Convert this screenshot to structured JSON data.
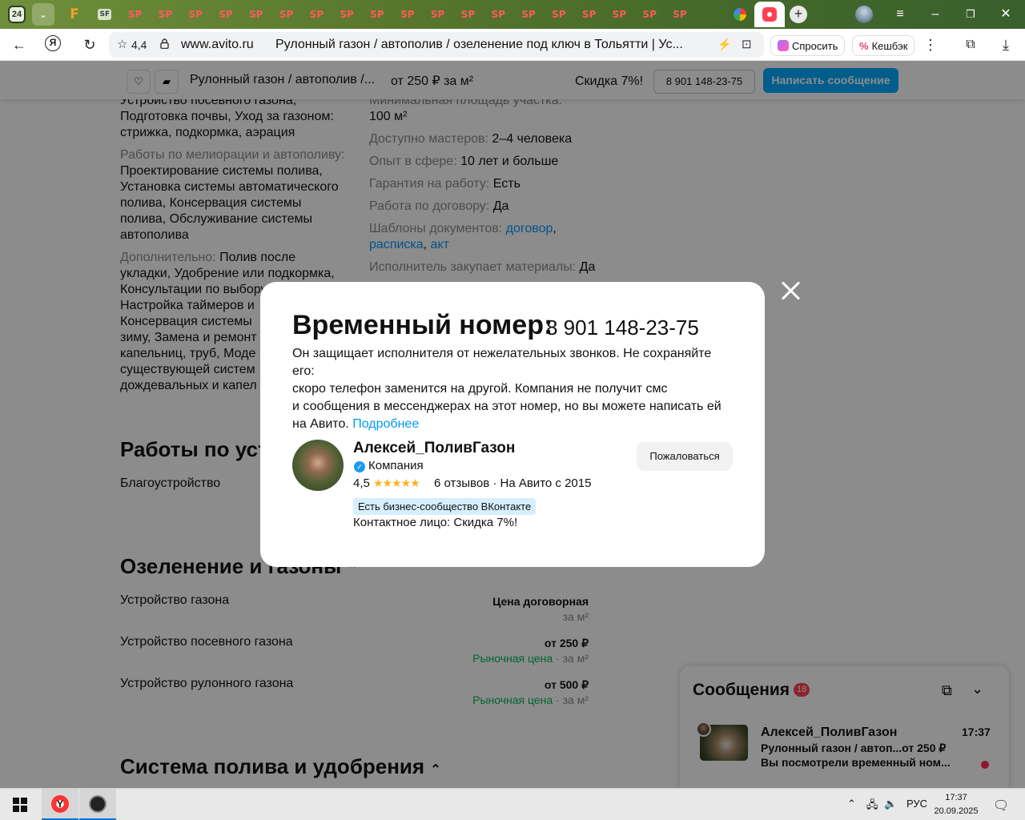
{
  "browser": {
    "tab_count_badge": "24",
    "favicons": [
      "F",
      "SF",
      "SP",
      "SP",
      "SP",
      "SP",
      "SP",
      "SP",
      "SP",
      "SP",
      "SP",
      "SP",
      "SP",
      "SP",
      "SP",
      "SP",
      "SP",
      "SP",
      "SP",
      "SP",
      "SP"
    ],
    "site_rating": "4,4",
    "domain": "www.avito.ru",
    "page_title": "Рулонный газон / автополив / озеленение под ключ в Тольятти | Ус...",
    "ask_label": "Спросить",
    "cashback_label": "Кешбэк"
  },
  "sticky": {
    "title": "Рулонный газон / автополив /...",
    "price": "от 250 ₽ за м²",
    "discount": "Скидка 7%!",
    "phone": "8 901 148-23-75",
    "message_button": "Написать сообщение"
  },
  "details_left": [
    {
      "text": "Устройство посевного газона,"
    },
    {
      "text": "Подготовка почвы, Уход за газоном:"
    },
    {
      "text": "стрижка, подкормка, аэрация"
    }
  ],
  "melioration": {
    "label": "Работы по мелиорации и автополиву:",
    "lines": [
      "Проектирование системы полива,",
      "Установка системы автоматического",
      "полива, Консервация системы",
      "полива, Обслуживание системы",
      "автополива"
    ]
  },
  "additional": {
    "label": "Дополнительно:",
    "first": "Полив после",
    "lines": [
      "укладки, Удобрение или подкормка,",
      "Консультации по выбору",
      "Настройка таймеров и",
      "Консервация системы",
      "зиму, Замена и ремонт",
      "капельниц, труб, Моде",
      "существующей систем",
      "дождевальных и капел"
    ]
  },
  "details_right": {
    "min_area_label": "Минимальная площадь участка:",
    "min_area_value": "100 м²",
    "masters_label": "Доступно мастеров:",
    "masters_value": "2–4 человека",
    "experience_label": "Опыт в сфере:",
    "experience_value": "10 лет и больше",
    "warranty_label": "Гарантия на работу:",
    "warranty_value": "Есть",
    "contract_label": "Работа по договору:",
    "contract_value": "Да",
    "templates_label": "Шаблоны документов:",
    "templates": [
      "договор",
      "расписка",
      "акт"
    ],
    "materials_label": "Исполнитель закупает материалы:",
    "materials_value": "Да"
  },
  "section_works": {
    "title": "Работы по уст",
    "item": "Благоустройство"
  },
  "section_greening": {
    "title": "Озеленение и газоны",
    "rows": [
      {
        "name": "Устройство газона",
        "price": "Цена договорная",
        "market": "",
        "unit": "за м²"
      },
      {
        "name": "Устройство посевного газона",
        "price": "от 250 ₽",
        "market": "Рыночная цена",
        "unit": "· за м²"
      },
      {
        "name": "Устройство рулонного газона",
        "price": "от 500 ₽",
        "market": "Рыночная цена",
        "unit": "· за м²"
      }
    ]
  },
  "section_irrigation": {
    "title": "Система полива и удобрения"
  },
  "messages": {
    "title": "Сообщения",
    "count": "18",
    "chat_name": "Алексей_ПоливГазон",
    "chat_time": "17:37",
    "chat_subject": "Рулонный газон / автоп...от 250 ₽",
    "chat_preview": "Вы посмотрели временный ном..."
  },
  "modal": {
    "title": "Временный номер:",
    "phone": "8 901 148-23-75",
    "desc_lines": [
      "Он защищает исполнителя от нежелательных звонков. Не сохраняйте его:",
      "скоро телефон заменится на другой. Компания не получит смс",
      "и сообщения в мессенджерах на этот номер, но вы можете написать ей"
    ],
    "desc_last": "на Авито.",
    "more_link": "Подробнее",
    "seller_name": "Алексей_ПоливГазон",
    "seller_type": "Компания",
    "rating": "4,5",
    "stars": "★★★★★",
    "reviews": "6 отзывов · На Авито с 2015",
    "vk_badge": "Есть бизнес-сообщество ВКонтакте",
    "contact": "Контактное лицо: Скидка 7%!",
    "report_button": "Пожаловаться"
  },
  "taskbar": {
    "lang": "РУС",
    "time": "17:37",
    "date": "20.09.2025"
  }
}
